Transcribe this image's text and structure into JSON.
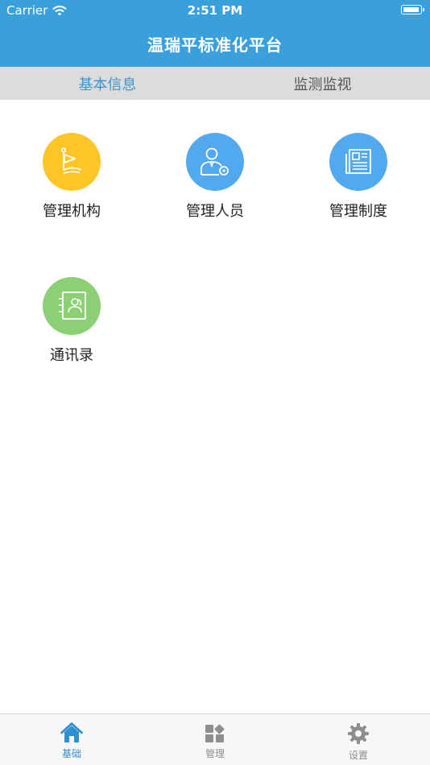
{
  "status_bar": {
    "carrier": "Carrier",
    "time": "2:51 PM",
    "wifi_icon": "wifi-icon",
    "battery_icon": "battery-icon"
  },
  "nav": {
    "title": "温瑞平标准化平台"
  },
  "tabs": [
    {
      "label": "基本信息",
      "active": true
    },
    {
      "label": "监测监视",
      "active": false
    }
  ],
  "grid": [
    {
      "label": "管理机构",
      "icon": "flag-icon",
      "color": "#fdc528"
    },
    {
      "label": "管理人员",
      "icon": "person-gear-icon",
      "color": "#53a9ee"
    },
    {
      "label": "管理制度",
      "icon": "document-icon",
      "color": "#53a9ee"
    },
    {
      "label": "通讯录",
      "icon": "contacts-icon",
      "color": "#8cd075"
    }
  ],
  "tabbar": [
    {
      "label": "基础",
      "icon": "home-icon",
      "active": true
    },
    {
      "label": "管理",
      "icon": "grid-diamond-icon",
      "active": false
    },
    {
      "label": "设置",
      "icon": "gear-icon",
      "active": false
    }
  ],
  "colors": {
    "header_bg": "#3aa0dc",
    "tab_strip_bg": "#dcdcdc",
    "accent": "#3a96cf"
  }
}
